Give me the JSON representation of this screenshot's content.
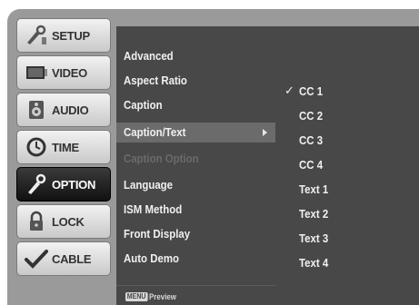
{
  "tabs": [
    {
      "label": "SETUP",
      "icon": "setup-icon"
    },
    {
      "label": "VIDEO",
      "icon": "video-icon"
    },
    {
      "label": "AUDIO",
      "icon": "audio-icon"
    },
    {
      "label": "TIME",
      "icon": "clock-icon"
    },
    {
      "label": "OPTION",
      "icon": "option-icon",
      "active": true
    },
    {
      "label": "LOCK",
      "icon": "lock-icon"
    },
    {
      "label": "CABLE",
      "icon": "cable-icon"
    }
  ],
  "menu": {
    "items": [
      {
        "label": "Advanced"
      },
      {
        "label": "Aspect Ratio"
      },
      {
        "label": "Caption"
      },
      {
        "label": "Caption/Text",
        "selected": true
      },
      {
        "label": "Caption Option",
        "disabled": true
      },
      {
        "label": "Language"
      },
      {
        "label": "ISM Method"
      },
      {
        "label": "Front Display"
      },
      {
        "label": "Auto Demo"
      }
    ],
    "preview_badge": "MENU",
    "preview_text": "Preview"
  },
  "submenu": {
    "checkmark": "✓",
    "checked_index": 0,
    "items": [
      "CC 1",
      "CC 2",
      "CC 3",
      "CC 4",
      "Text 1",
      "Text 2",
      "Text 3",
      "Text 4"
    ]
  },
  "colors": {
    "panel": "#484848",
    "highlight": "#6b6b6b",
    "frame": "#9a9a9a"
  }
}
